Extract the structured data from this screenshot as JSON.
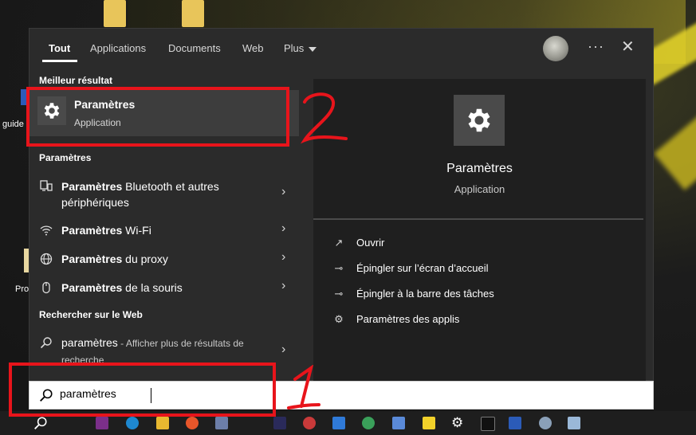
{
  "desktop": {
    "labels": [
      "guide",
      "Pro"
    ]
  },
  "tabs": [
    {
      "label": "Tout"
    },
    {
      "label": "Applications"
    },
    {
      "label": "Documents"
    },
    {
      "label": "Web"
    },
    {
      "label": "Plus"
    }
  ],
  "header_icons": {
    "more": "more-icon",
    "close": "close-icon",
    "avatar": "avatar"
  },
  "left": {
    "best_header": "Meilleur résultat",
    "best": {
      "title": "Paramètres",
      "subtitle": "Application",
      "icon": "gear-icon"
    },
    "settings_header": "Paramètres",
    "settings_items": [
      {
        "bold": "Paramètres",
        "rest": " Bluetooth et autres périphériques",
        "icon": "bluetooth-devices-icon"
      },
      {
        "bold": "Paramètres",
        "rest": " Wi-Fi",
        "icon": "wifi-icon"
      },
      {
        "bold": "Paramètres",
        "rest": " du proxy",
        "icon": "globe-icon"
      },
      {
        "bold": "Paramètres",
        "rest": " de la souris",
        "icon": "mouse-icon"
      }
    ],
    "web_header": "Rechercher sur le Web",
    "web_item": {
      "query": "paramètres",
      "sub": " - Afficher plus de résultats de recherche",
      "icon": "search-icon"
    }
  },
  "preview": {
    "title": "Paramètres",
    "subtitle": "Application",
    "actions": [
      {
        "label": "Ouvrir",
        "icon": "open-icon"
      },
      {
        "label": "Épingler sur l’écran d’accueil",
        "icon": "pin-icon"
      },
      {
        "label": "Épingler à la barre des tâches",
        "icon": "pin-icon"
      },
      {
        "label": "Paramètres des applis",
        "icon": "gear-icon"
      }
    ]
  },
  "search": {
    "value": "paramètres",
    "icon": "search-icon"
  },
  "annotations": {
    "label_1": "1",
    "label_2": "2",
    "color": "#e8141b"
  },
  "colors": {
    "panel": "#2b2b2b",
    "selected": "#3d3d3d",
    "preview": "#1f1f1f",
    "accent_red": "#e8141b"
  }
}
